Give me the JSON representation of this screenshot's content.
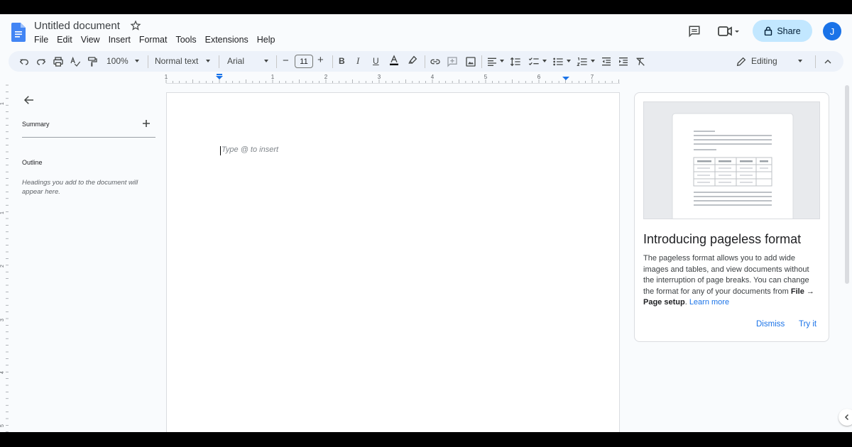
{
  "document": {
    "title": "Untitled document"
  },
  "menu": [
    "File",
    "Edit",
    "View",
    "Insert",
    "Format",
    "Tools",
    "Extensions",
    "Help"
  ],
  "header": {
    "share_label": "Share",
    "avatar_initial": "J"
  },
  "toolbar": {
    "zoom": "100%",
    "style": "Normal text",
    "font": "Arial",
    "font_size": "11",
    "minus": "−",
    "plus": "+",
    "bold": "B",
    "italic": "I",
    "underline": "U",
    "mode": "Editing"
  },
  "ruler": {
    "labels": [
      "1",
      "1",
      "2",
      "3",
      "4",
      "5",
      "6",
      "7"
    ]
  },
  "vruler": {
    "labels": [
      "1",
      "1",
      "2",
      "3",
      "4",
      "5"
    ]
  },
  "sidebar": {
    "summary_label": "Summary",
    "outline_label": "Outline",
    "outline_hint": "Headings you add to the document will appear here."
  },
  "page": {
    "placeholder": "Type @ to insert"
  },
  "card": {
    "title": "Introducing pageless format",
    "body_intro": "The pageless format allows you to add wide images and tables, and view documents without the interruption of page breaks. You can change the format for any of your documents from ",
    "body_path": "File → Page setup",
    "body_end": ". ",
    "learn_more": "Learn more",
    "dismiss": "Dismiss",
    "try_it": "Try it"
  },
  "colors": {
    "accent": "#1a73e8",
    "share_bg": "#c2e7ff",
    "toolbar_bg": "#edf2fa"
  }
}
